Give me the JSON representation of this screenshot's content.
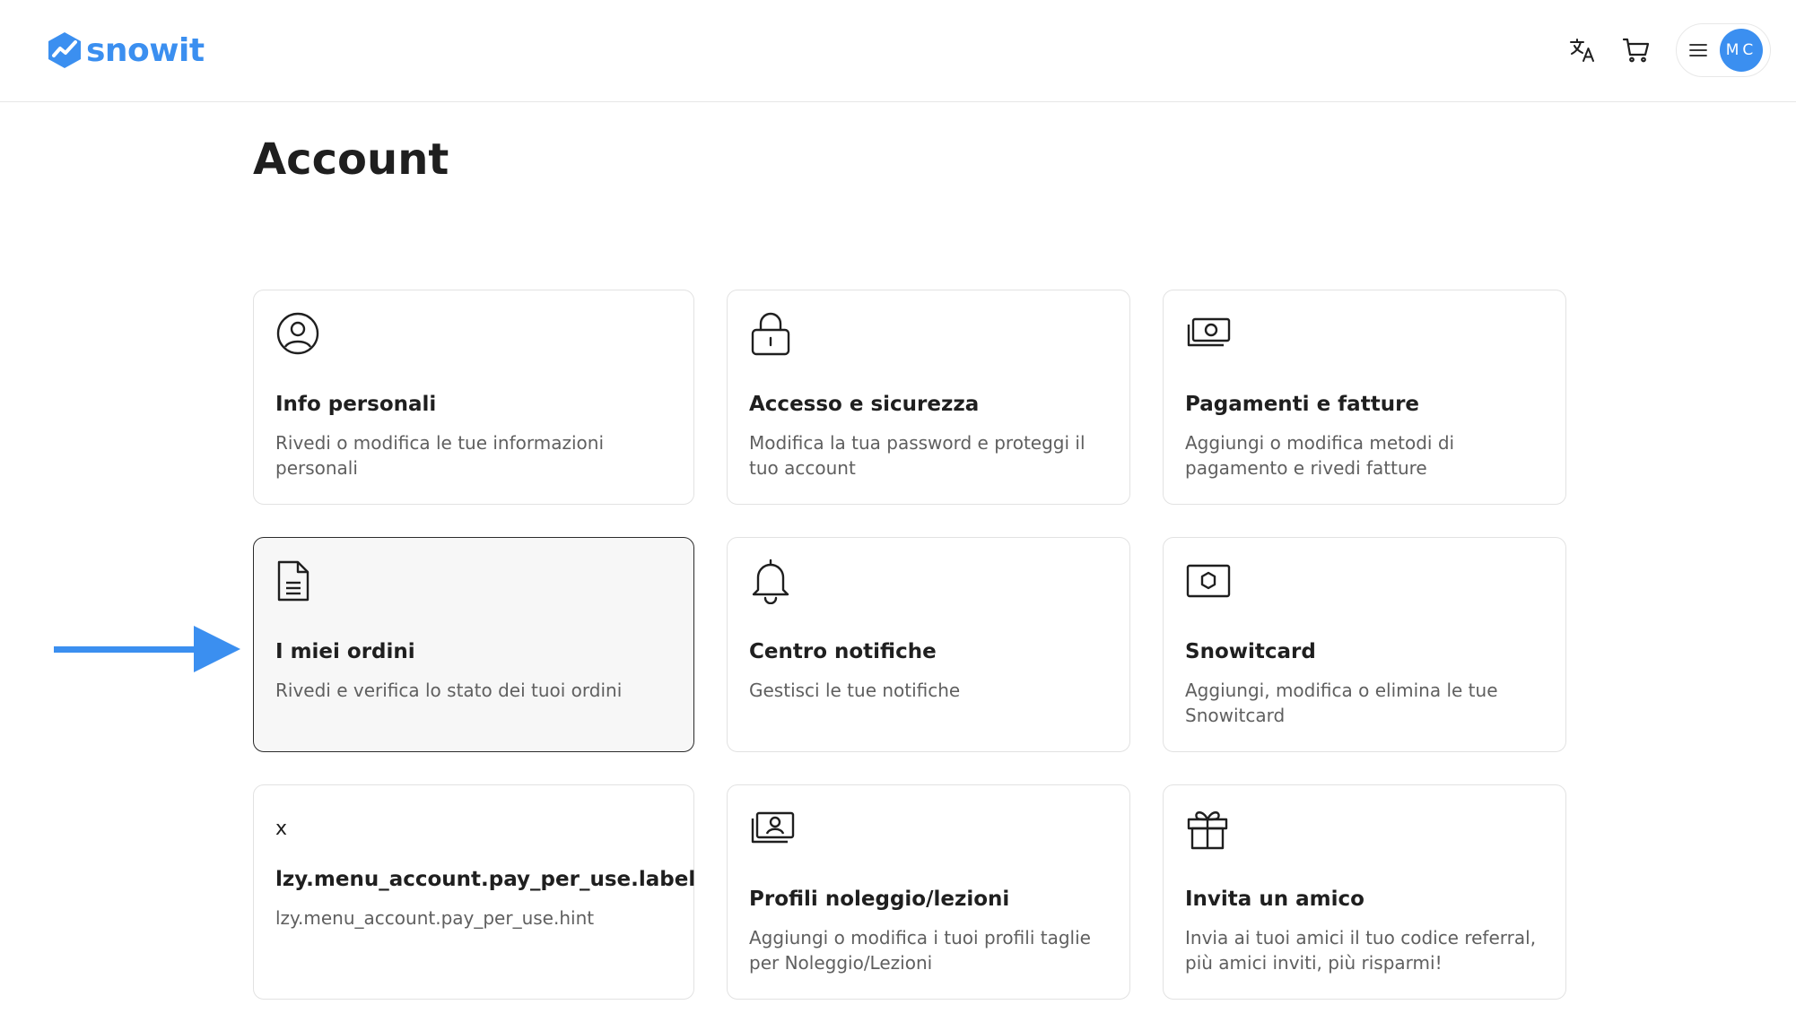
{
  "header": {
    "logo_text": "snowit",
    "icons": [
      "translate-icon",
      "cart-icon",
      "hamburger-icon"
    ],
    "avatar_initials": "MC",
    "brand_color": "#3b8ff0"
  },
  "page": {
    "title": "Account"
  },
  "cards": [
    {
      "icon": "user-circle-icon",
      "title": "Info personali",
      "description": "Rivedi o modifica le tue informazioni personali"
    },
    {
      "icon": "lock-icon",
      "title": "Accesso e sicurezza",
      "description": "Modifica la tua password e proteggi il tuo account"
    },
    {
      "icon": "money-icon",
      "title": "Pagamenti e fatture",
      "description": "Aggiungi o modifica metodi di pagamento e rivedi fatture"
    },
    {
      "icon": "document-icon",
      "title": "I miei ordini",
      "description": "Rivedi e verifica lo stato dei tuoi ordini",
      "active": true
    },
    {
      "icon": "bell-icon",
      "title": "Centro notifiche",
      "description": "Gestisci le tue notifiche"
    },
    {
      "icon": "snowitcard-icon",
      "title": "Snowitcard",
      "description": "Aggiungi, modifica o elimina le tue Snowitcard"
    },
    {
      "icon": "x-icon",
      "icon_text": "x",
      "title": "lzy.menu_account.pay_per_use.label",
      "description": "lzy.menu_account.pay_per_use.hint"
    },
    {
      "icon": "profile-card-icon",
      "title": "Profili noleggio/lezioni",
      "description": "Aggiungi o modifica i tuoi profili taglie per Noleggio/Lezioni"
    },
    {
      "icon": "gift-icon",
      "title": "Invita un amico",
      "description": "Invia ai tuoi amici il tuo codice referral, più amici inviti, più risparmi!"
    }
  ],
  "annotation": {
    "icon": "arrow-right-icon",
    "color": "#3b8ff0"
  }
}
